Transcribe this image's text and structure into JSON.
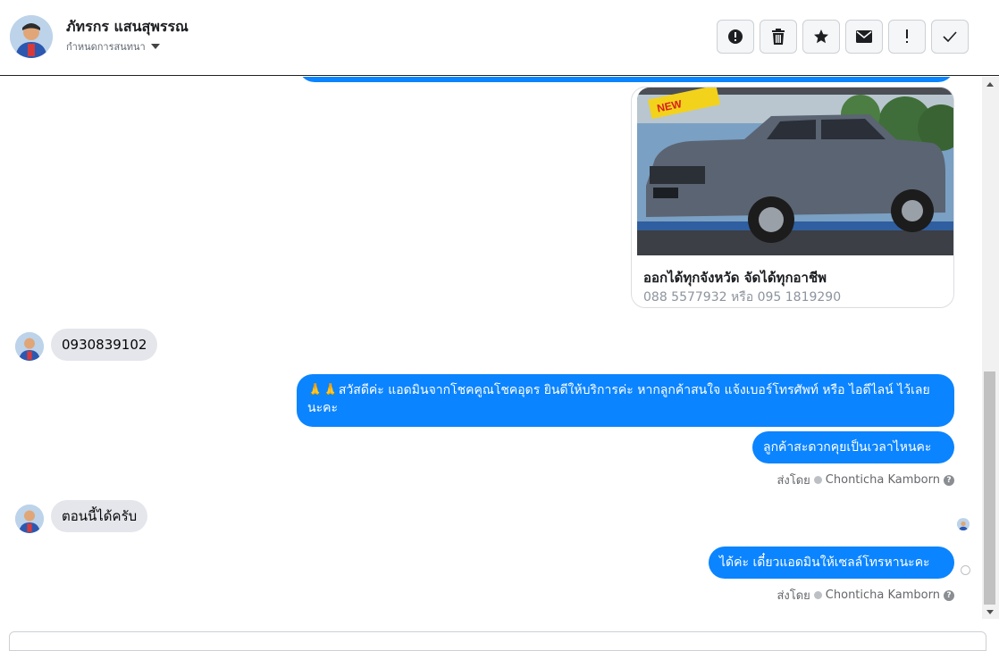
{
  "header": {
    "name": "ภัทรกร แสนสุพรรณ",
    "assign_label": "กำหนดการสนทนา"
  },
  "actions": [
    {
      "icon": "alert-circle-icon"
    },
    {
      "icon": "trash-icon"
    },
    {
      "icon": "star-icon"
    },
    {
      "icon": "envelope-icon"
    },
    {
      "icon": "exclamation-icon"
    },
    {
      "icon": "check-icon"
    }
  ],
  "card": {
    "image_badge": "NEW",
    "title": "ออกได้ทุกจังหวัด จัดได้ทุกอาชีพ",
    "subtitle": "088 5577932 หรือ 095 1819290"
  },
  "messages": {
    "in1": "0930839102",
    "out1": "🙏🙏สวัสดีค่ะ แอดมินจากโชคคูณโชคอุดร ยินดีให้บริการค่ะ หากลูกค้าสนใจ แจ้งเบอร์โทรศัพท์ หรือ ไอดีไลน์ ไว้เลยนะคะ",
    "out2": "ลูกค้าสะดวกคุยเป็นเวลาไหนคะ",
    "in2": "ตอนนี้ได้ครับ",
    "out3": "ได้ค่ะ เดี๋ยวแอดมินให้เซลล์โทรหานะคะ"
  },
  "sent_by": {
    "prefix": "ส่งโดย",
    "agent": "Chonticha Kamborn"
  },
  "colors": {
    "outgoing_bubble": "#0b84ff",
    "incoming_bubble": "#e4e6eb"
  }
}
